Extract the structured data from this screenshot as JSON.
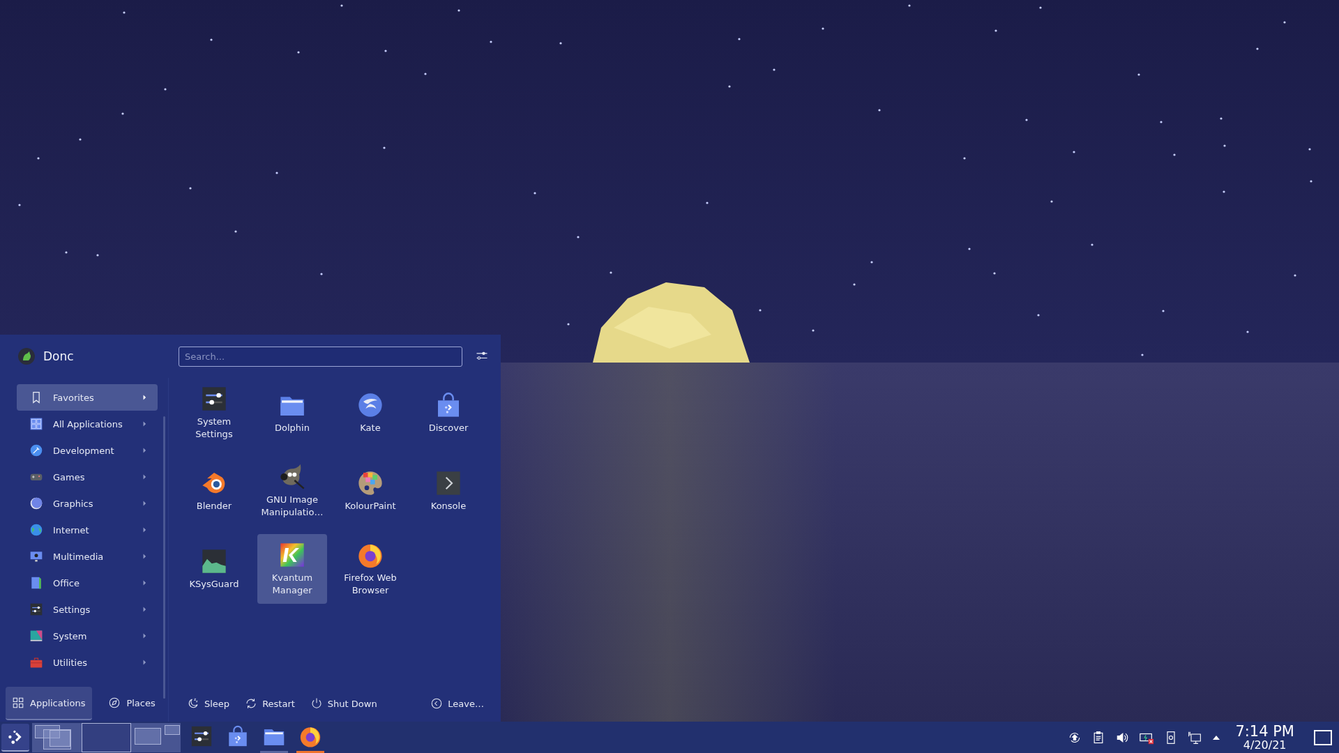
{
  "menu": {
    "user": "Donc",
    "search": {
      "placeholder": "Search..."
    },
    "categories": [
      {
        "label": "Favorites",
        "selected": true
      },
      {
        "label": "All Applications",
        "selected": false
      },
      {
        "label": "Development",
        "selected": false
      },
      {
        "label": "Games",
        "selected": false
      },
      {
        "label": "Graphics",
        "selected": false
      },
      {
        "label": "Internet",
        "selected": false
      },
      {
        "label": "Multimedia",
        "selected": false
      },
      {
        "label": "Office",
        "selected": false
      },
      {
        "label": "Settings",
        "selected": false
      },
      {
        "label": "System",
        "selected": false
      },
      {
        "label": "Utilities",
        "selected": false
      }
    ],
    "apps": [
      {
        "label": "System Settings",
        "selected": false
      },
      {
        "label": "Dolphin",
        "selected": false
      },
      {
        "label": "Kate",
        "selected": false
      },
      {
        "label": "Discover",
        "selected": false
      },
      {
        "label": "Blender",
        "selected": false
      },
      {
        "label": "GNU Image Manipulatio…",
        "selected": false
      },
      {
        "label": "KolourPaint",
        "selected": false
      },
      {
        "label": "Konsole",
        "selected": false
      },
      {
        "label": "KSysGuard",
        "selected": false
      },
      {
        "label": "Kvantum Manager",
        "selected": true
      },
      {
        "label": "Firefox Web Browser",
        "selected": false
      }
    ],
    "tabs": [
      {
        "label": "Applications",
        "selected": true
      },
      {
        "label": "Places",
        "selected": false
      }
    ],
    "power_actions": [
      "Sleep",
      "Restart",
      "Shut Down"
    ],
    "leave": "Leave…"
  },
  "taskbar": {
    "desktops": [
      {
        "selected": false
      },
      {
        "selected": true
      },
      {
        "selected": false
      }
    ],
    "tasks": [
      {
        "open": false,
        "attention": false
      },
      {
        "open": false,
        "attention": false
      },
      {
        "open": true,
        "attention": false
      },
      {
        "open": true,
        "attention": true
      }
    ],
    "clock": {
      "time": "7:14 PM",
      "date": "4/20/21"
    }
  }
}
